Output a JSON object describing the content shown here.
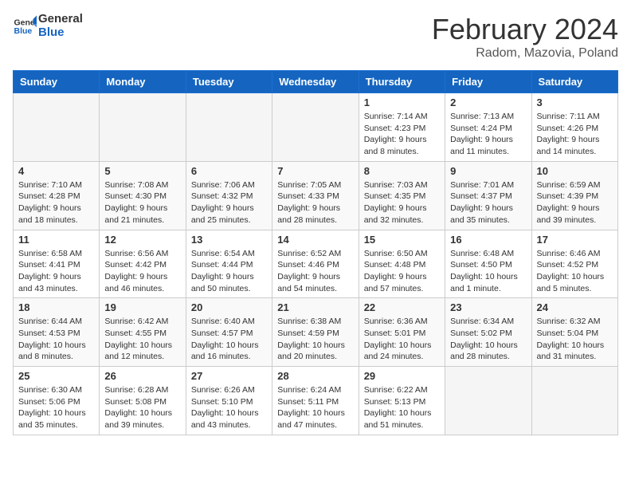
{
  "header": {
    "logo_general": "General",
    "logo_blue": "Blue",
    "title": "February 2024",
    "subtitle": "Radom, Mazovia, Poland"
  },
  "days_of_week": [
    "Sunday",
    "Monday",
    "Tuesday",
    "Wednesday",
    "Thursday",
    "Friday",
    "Saturday"
  ],
  "weeks": [
    [
      {
        "day": "",
        "info": ""
      },
      {
        "day": "",
        "info": ""
      },
      {
        "day": "",
        "info": ""
      },
      {
        "day": "",
        "info": ""
      },
      {
        "day": "1",
        "info": "Sunrise: 7:14 AM\nSunset: 4:23 PM\nDaylight: 9 hours\nand 8 minutes."
      },
      {
        "day": "2",
        "info": "Sunrise: 7:13 AM\nSunset: 4:24 PM\nDaylight: 9 hours\nand 11 minutes."
      },
      {
        "day": "3",
        "info": "Sunrise: 7:11 AM\nSunset: 4:26 PM\nDaylight: 9 hours\nand 14 minutes."
      }
    ],
    [
      {
        "day": "4",
        "info": "Sunrise: 7:10 AM\nSunset: 4:28 PM\nDaylight: 9 hours\nand 18 minutes."
      },
      {
        "day": "5",
        "info": "Sunrise: 7:08 AM\nSunset: 4:30 PM\nDaylight: 9 hours\nand 21 minutes."
      },
      {
        "day": "6",
        "info": "Sunrise: 7:06 AM\nSunset: 4:32 PM\nDaylight: 9 hours\nand 25 minutes."
      },
      {
        "day": "7",
        "info": "Sunrise: 7:05 AM\nSunset: 4:33 PM\nDaylight: 9 hours\nand 28 minutes."
      },
      {
        "day": "8",
        "info": "Sunrise: 7:03 AM\nSunset: 4:35 PM\nDaylight: 9 hours\nand 32 minutes."
      },
      {
        "day": "9",
        "info": "Sunrise: 7:01 AM\nSunset: 4:37 PM\nDaylight: 9 hours\nand 35 minutes."
      },
      {
        "day": "10",
        "info": "Sunrise: 6:59 AM\nSunset: 4:39 PM\nDaylight: 9 hours\nand 39 minutes."
      }
    ],
    [
      {
        "day": "11",
        "info": "Sunrise: 6:58 AM\nSunset: 4:41 PM\nDaylight: 9 hours\nand 43 minutes."
      },
      {
        "day": "12",
        "info": "Sunrise: 6:56 AM\nSunset: 4:42 PM\nDaylight: 9 hours\nand 46 minutes."
      },
      {
        "day": "13",
        "info": "Sunrise: 6:54 AM\nSunset: 4:44 PM\nDaylight: 9 hours\nand 50 minutes."
      },
      {
        "day": "14",
        "info": "Sunrise: 6:52 AM\nSunset: 4:46 PM\nDaylight: 9 hours\nand 54 minutes."
      },
      {
        "day": "15",
        "info": "Sunrise: 6:50 AM\nSunset: 4:48 PM\nDaylight: 9 hours\nand 57 minutes."
      },
      {
        "day": "16",
        "info": "Sunrise: 6:48 AM\nSunset: 4:50 PM\nDaylight: 10 hours\nand 1 minute."
      },
      {
        "day": "17",
        "info": "Sunrise: 6:46 AM\nSunset: 4:52 PM\nDaylight: 10 hours\nand 5 minutes."
      }
    ],
    [
      {
        "day": "18",
        "info": "Sunrise: 6:44 AM\nSunset: 4:53 PM\nDaylight: 10 hours\nand 8 minutes."
      },
      {
        "day": "19",
        "info": "Sunrise: 6:42 AM\nSunset: 4:55 PM\nDaylight: 10 hours\nand 12 minutes."
      },
      {
        "day": "20",
        "info": "Sunrise: 6:40 AM\nSunset: 4:57 PM\nDaylight: 10 hours\nand 16 minutes."
      },
      {
        "day": "21",
        "info": "Sunrise: 6:38 AM\nSunset: 4:59 PM\nDaylight: 10 hours\nand 20 minutes."
      },
      {
        "day": "22",
        "info": "Sunrise: 6:36 AM\nSunset: 5:01 PM\nDaylight: 10 hours\nand 24 minutes."
      },
      {
        "day": "23",
        "info": "Sunrise: 6:34 AM\nSunset: 5:02 PM\nDaylight: 10 hours\nand 28 minutes."
      },
      {
        "day": "24",
        "info": "Sunrise: 6:32 AM\nSunset: 5:04 PM\nDaylight: 10 hours\nand 31 minutes."
      }
    ],
    [
      {
        "day": "25",
        "info": "Sunrise: 6:30 AM\nSunset: 5:06 PM\nDaylight: 10 hours\nand 35 minutes."
      },
      {
        "day": "26",
        "info": "Sunrise: 6:28 AM\nSunset: 5:08 PM\nDaylight: 10 hours\nand 39 minutes."
      },
      {
        "day": "27",
        "info": "Sunrise: 6:26 AM\nSunset: 5:10 PM\nDaylight: 10 hours\nand 43 minutes."
      },
      {
        "day": "28",
        "info": "Sunrise: 6:24 AM\nSunset: 5:11 PM\nDaylight: 10 hours\nand 47 minutes."
      },
      {
        "day": "29",
        "info": "Sunrise: 6:22 AM\nSunset: 5:13 PM\nDaylight: 10 hours\nand 51 minutes."
      },
      {
        "day": "",
        "info": ""
      },
      {
        "day": "",
        "info": ""
      }
    ]
  ]
}
